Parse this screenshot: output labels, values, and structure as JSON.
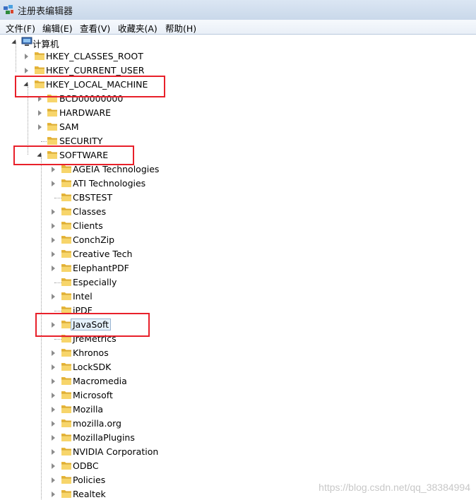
{
  "window": {
    "title": "注册表编辑器",
    "icon": "regedit-icon"
  },
  "menu": [
    {
      "label": "文件(F)",
      "name": "menu-file"
    },
    {
      "label": "编辑(E)",
      "name": "menu-edit"
    },
    {
      "label": "查看(V)",
      "name": "menu-view"
    },
    {
      "label": "收藏夹(A)",
      "name": "menu-favorites"
    },
    {
      "label": "帮助(H)",
      "name": "menu-help"
    }
  ],
  "tree": [
    {
      "label": "计算机",
      "level": 0,
      "state": "expanded",
      "icon": "computer-icon"
    },
    {
      "label": "HKEY_CLASSES_ROOT",
      "level": 1,
      "state": "collapsed"
    },
    {
      "label": "HKEY_CURRENT_USER",
      "level": 1,
      "state": "collapsed"
    },
    {
      "label": "HKEY_LOCAL_MACHINE",
      "level": 1,
      "state": "expanded",
      "highlight": true
    },
    {
      "label": "BCD00000000",
      "level": 2,
      "state": "collapsed"
    },
    {
      "label": "HARDWARE",
      "level": 2,
      "state": "collapsed"
    },
    {
      "label": "SAM",
      "level": 2,
      "state": "collapsed"
    },
    {
      "label": "SECURITY",
      "level": 2,
      "state": "leaf"
    },
    {
      "label": "SOFTWARE",
      "level": 2,
      "state": "expanded",
      "highlight": true
    },
    {
      "label": "AGEIA Technologies",
      "level": 3,
      "state": "collapsed"
    },
    {
      "label": "ATI Technologies",
      "level": 3,
      "state": "collapsed"
    },
    {
      "label": "CBSTEST",
      "level": 3,
      "state": "leaf"
    },
    {
      "label": "Classes",
      "level": 3,
      "state": "collapsed"
    },
    {
      "label": "Clients",
      "level": 3,
      "state": "collapsed"
    },
    {
      "label": "ConchZip",
      "level": 3,
      "state": "collapsed"
    },
    {
      "label": "Creative Tech",
      "level": 3,
      "state": "collapsed"
    },
    {
      "label": "ElephantPDF",
      "level": 3,
      "state": "collapsed"
    },
    {
      "label": "Especially",
      "level": 3,
      "state": "leaf"
    },
    {
      "label": "Intel",
      "level": 3,
      "state": "collapsed"
    },
    {
      "label": "iPDF",
      "level": 3,
      "state": "leaf"
    },
    {
      "label": "JavaSoft",
      "level": 3,
      "state": "collapsed",
      "highlight": true,
      "selected": true
    },
    {
      "label": "JreMetrics",
      "level": 3,
      "state": "leaf"
    },
    {
      "label": "Khronos",
      "level": 3,
      "state": "collapsed"
    },
    {
      "label": "LockSDK",
      "level": 3,
      "state": "collapsed"
    },
    {
      "label": "Macromedia",
      "level": 3,
      "state": "collapsed"
    },
    {
      "label": "Microsoft",
      "level": 3,
      "state": "collapsed"
    },
    {
      "label": "Mozilla",
      "level": 3,
      "state": "collapsed"
    },
    {
      "label": "mozilla.org",
      "level": 3,
      "state": "collapsed"
    },
    {
      "label": "MozillaPlugins",
      "level": 3,
      "state": "collapsed"
    },
    {
      "label": "NVIDIA Corporation",
      "level": 3,
      "state": "collapsed"
    },
    {
      "label": "ODBC",
      "level": 3,
      "state": "collapsed"
    },
    {
      "label": "Policies",
      "level": 3,
      "state": "collapsed"
    },
    {
      "label": "Realtek",
      "level": 3,
      "state": "collapsed"
    }
  ],
  "watermark": "https://blog.csdn.net/qq_38384994",
  "colors": {
    "highlight_border": "#e8202a",
    "selection_bg": "#e5f1fb",
    "folder": "#f0c44c"
  }
}
